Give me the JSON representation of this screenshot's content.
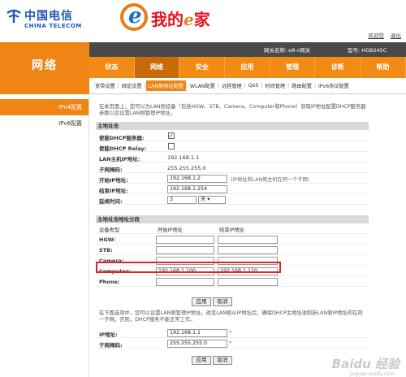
{
  "brand": {
    "telecom_cn": "中国电信",
    "telecom_en": "CHINA TELECOM",
    "ehome_text": "我的",
    "ehome_e": "e",
    "ehome_suffix": "家"
  },
  "toplinks": [
    "欢迎您",
    "退出"
  ],
  "infobar": {
    "gateway_name": "网关名称: e8-c网关",
    "model": "型号: HG8245C"
  },
  "section_title": "网络",
  "nav": [
    "状态",
    "网络",
    "安全",
    "应用",
    "管理",
    "诊断",
    "帮助"
  ],
  "subnav": [
    "宽带设置",
    "绑定设置",
    "LAN侧地址配置",
    "WLAN配置",
    "远程管理",
    "QoS",
    "时间管理",
    "路由配置",
    "IPv6协议配置"
  ],
  "sidebar": [
    "IPv4配置",
    "IPv6配置"
  ],
  "description1": "在本页面上，您可以为LAN侧设备（包括HGW、STB、Camera、Computer和Phone）获取IP地址配置DHCP服务器参数以及设置LAN侧管理IP地址。",
  "host_section": {
    "title": "主地址池",
    "dhcp_server_label": "使能DHCP服务器:",
    "dhcp_relay_label": "使能DHCP Relay:",
    "lan_ip_label": "LAN主机IP地址:",
    "lan_ip": "192.168.1.1",
    "mask_label": "子网掩码:",
    "mask": "255.255.255.0",
    "start_label": "开始IP地址:",
    "start_ip": "192.168.1.2",
    "start_hint": "(IP地址和LAN侧主机在同一个子网)",
    "end_label": "结束IP地址:",
    "end_ip": "192.168.1.254",
    "lease_label": "延续时间:",
    "lease_value": "3",
    "lease_unit": "天"
  },
  "pool_section": {
    "title": "主地址池地址分段",
    "col_device": "设备类型",
    "col_start": "开始IP地址",
    "col_end": "结束IP地址",
    "rows": [
      {
        "device": "HGW:",
        "start": "",
        "end": ""
      },
      {
        "device": "STB:",
        "start": "",
        "end": ""
      },
      {
        "device": "Camera:",
        "start": "",
        "end": ""
      },
      {
        "device": "Computer:",
        "start": "192.168.1.100",
        "end": "192.168.1.120"
      },
      {
        "device": "Phone:",
        "start": "",
        "end": ""
      }
    ]
  },
  "buttons": {
    "apply": "应用",
    "cancel": "取消"
  },
  "description2": "在下面选项中，您可以设置LAN侧管理IP地址。改变LAN侧从IP地址后，确保DHCP主地址池和新LAN侧IP地址的在同一子网，否则，DHCP服务不能正常工作。",
  "mgmt_section": {
    "ip_label": "IP地址:",
    "ip": "192.168.1.1",
    "mask_label": "子网掩码:",
    "mask": "255.255.255.0",
    "star": "*"
  },
  "watermark": "Baidu 经验",
  "watermark_sub": "jingyan.baidu.com",
  "colors": {
    "orange": "#f28a14",
    "highlight": "#e0242b",
    "brand_blue": "#1a58b0"
  }
}
